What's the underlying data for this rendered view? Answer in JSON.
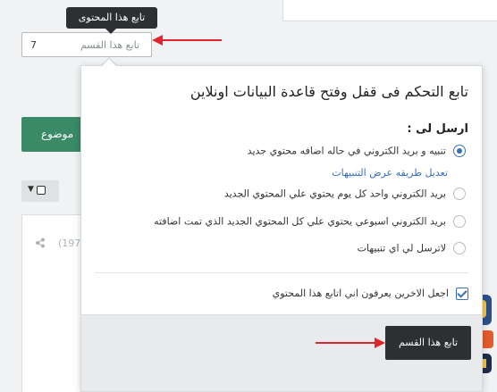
{
  "tooltip": {
    "text": "تابع هذا المحتوى"
  },
  "follow_box": {
    "label": "تابع هذا القسم",
    "count": "7"
  },
  "green_button": {
    "label": "موضوع"
  },
  "card": {
    "count": "(197"
  },
  "panel": {
    "title": "تابع التحكم فى قفل وفتح قاعدة البيانات اونلاين",
    "send_label": "ارسل لى :",
    "options": [
      {
        "label": "تنبيه و بريد الكتروني في حاله اضافه محتوي جديد",
        "selected": true
      },
      {
        "label": "بريد الكتروني واحد كل يوم يحتوي علي المحتوي الجديد",
        "selected": false
      },
      {
        "label": "بريد الكتروني اسبوعي يحتوي علي كل المحتوي الجديد الذي تمت اضافته",
        "selected": false
      },
      {
        "label": "لاترسل لي اي تنبيهات",
        "selected": false
      }
    ],
    "edit_link": "تعديل طريقه عرض التنبيهات",
    "anonymous_checkbox": {
      "label": "اجعل الاخرين يعرفون اني اتابع هذا المحتوي",
      "checked": true
    },
    "submit_label": "تابع هذا القسم"
  },
  "colors": {
    "accent": "#3a6fb8",
    "dark": "#2e2f33",
    "green": "#3a8a66",
    "arrow": "#e0262d"
  }
}
